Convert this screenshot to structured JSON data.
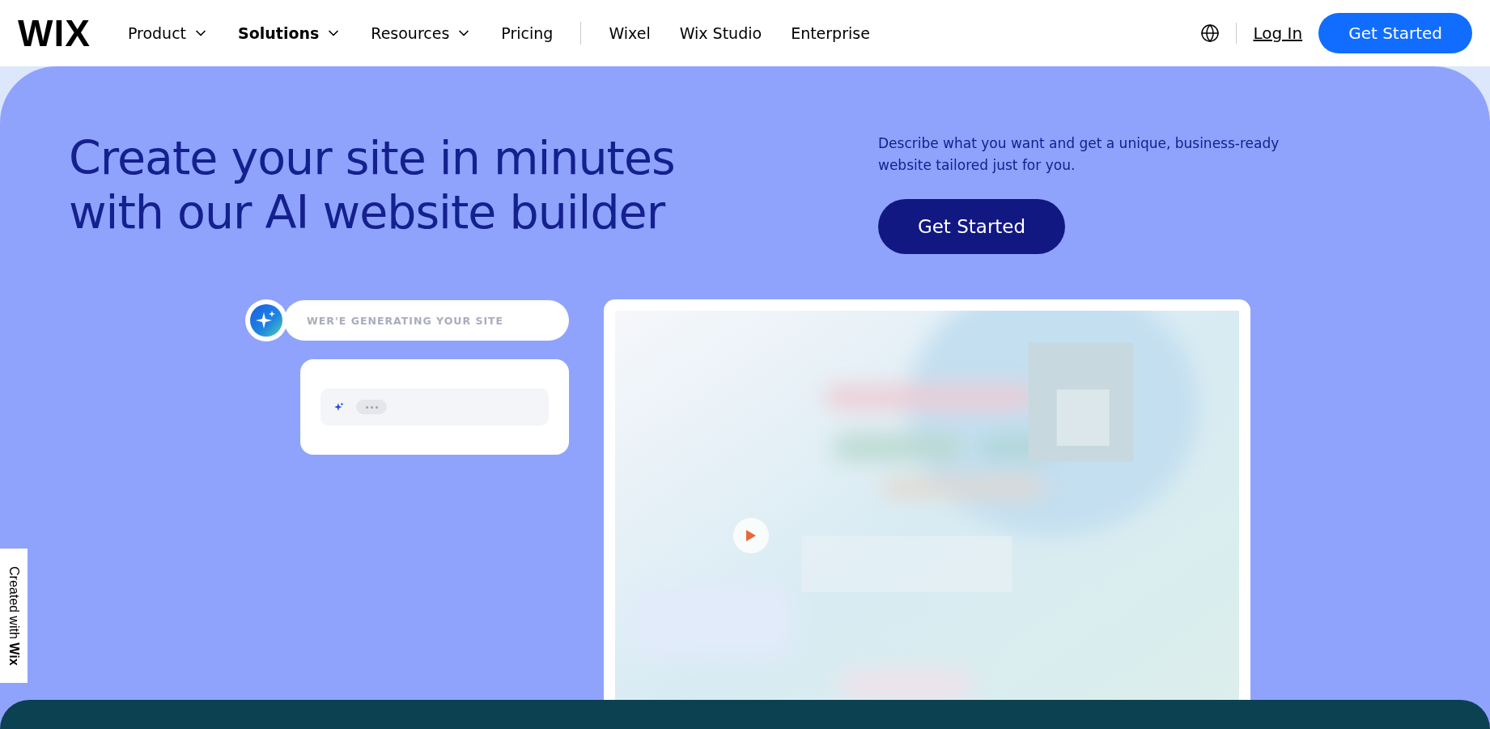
{
  "nav": {
    "logo": "WIX",
    "menu_items": [
      {
        "label": "Product",
        "dropdown": true,
        "selected": false
      },
      {
        "label": "Solutions",
        "dropdown": true,
        "selected": true
      },
      {
        "label": "Resources",
        "dropdown": true,
        "selected": false
      },
      {
        "label": "Pricing",
        "dropdown": false,
        "selected": false
      }
    ],
    "product_links": [
      "Wixel",
      "Wix Studio",
      "Enterprise"
    ],
    "login": "Log In",
    "cta": "Get Started"
  },
  "hero": {
    "title_lines": [
      "Create your site in minutes",
      "with our AI website builder"
    ],
    "description": "Describe what you want and get a unique, business-ready website tailored just for you.",
    "cta": "Get Started",
    "chat": {
      "status": "WER'E GENERATING YOUR SITE"
    },
    "preview": {
      "kind": "picture"
    }
  },
  "badge": "Created with **Wix**"
}
